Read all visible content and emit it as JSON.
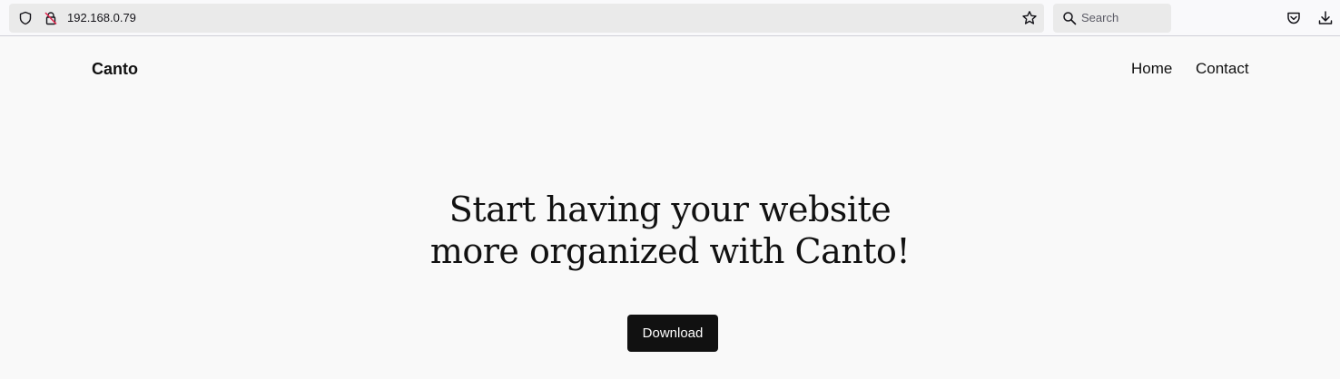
{
  "browser": {
    "url": "192.168.0.79",
    "search_placeholder": "Search",
    "icons": [
      "shield-icon",
      "insecure-lock-icon",
      "bookmark-star-icon",
      "search-icon",
      "pocket-icon",
      "download-icon"
    ]
  },
  "site": {
    "brand": "Canto",
    "nav": [
      {
        "label": "Home"
      },
      {
        "label": "Contact"
      }
    ]
  },
  "hero": {
    "title_line1": "Start having your website",
    "title_line2": "more organized with Canto!",
    "button_label": "Download"
  },
  "colors": {
    "page_background": "#f9f9f9",
    "text": "#111111",
    "button_background": "#111111",
    "button_text": "#ffffff",
    "urlbar_background": "#eaeaea"
  }
}
